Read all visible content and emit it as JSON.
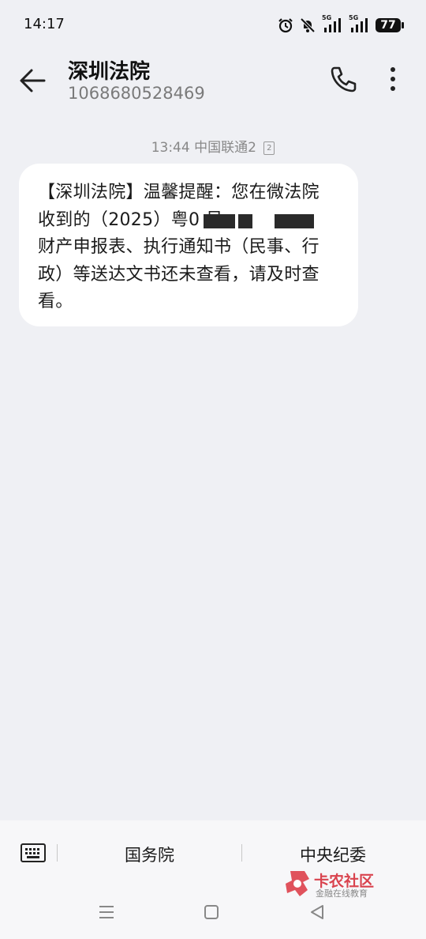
{
  "status": {
    "time": "14:17",
    "signal1": "5G",
    "signal2": "5G",
    "battery": "77"
  },
  "header": {
    "title": "深圳法院",
    "number": "1068680528469"
  },
  "message": {
    "meta": "13:44 中国联通2",
    "sim_badge": "2",
    "lines": [
      "【深圳法院】温馨提醒：您在微法院",
      "收到的（2025）粤0              号",
      "财产申报表、执行通知书（民事、行",
      "政）等送达文书还未查看，请及时查",
      "看。"
    ]
  },
  "quick_replies": {
    "item1": "国务院",
    "item2": "中央纪委"
  },
  "watermark": {
    "text": "卡农社区",
    "subtext": "金融在线教育"
  }
}
